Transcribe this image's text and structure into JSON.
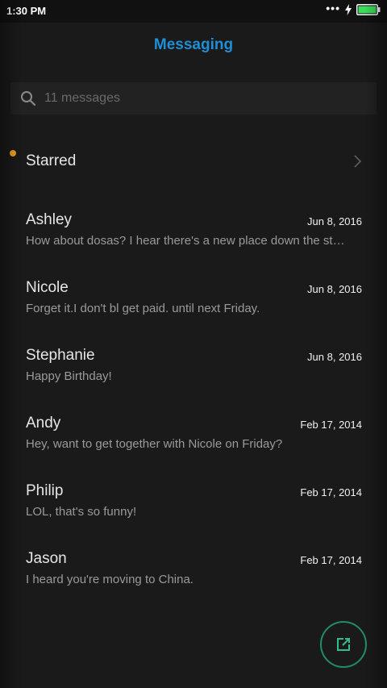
{
  "status_bar": {
    "time": "1:30 PM",
    "battery_color": "#3ddc5a"
  },
  "header": {
    "title": "Messaging",
    "title_color": "#1e8fd6"
  },
  "search": {
    "placeholder": "11 messages"
  },
  "starred": {
    "label": "Starred"
  },
  "conversations": [
    {
      "name": "Ashley",
      "date": "Jun 8, 2016",
      "preview": "How about dosas? I hear there's a new place down the st…",
      "unread": false
    },
    {
      "name": "Nicole",
      "date": "Jun 8, 2016",
      "preview": "Forget it.I don't bl get paid. until next Friday.",
      "unread": false
    },
    {
      "name": "Stephanie",
      "date": "Jun 8, 2016",
      "preview": "Happy Birthday!",
      "unread": true
    },
    {
      "name": "Andy",
      "date": "Feb 17, 2014",
      "preview": "Hey, want to get together with Nicole on Friday?",
      "unread": false
    },
    {
      "name": "Philip",
      "date": "Feb 17, 2014",
      "preview": "LOL, that's so funny!",
      "unread": false
    },
    {
      "name": "Jason",
      "date": "Feb 17, 2014",
      "preview": "I heard you're moving to China.",
      "unread": false
    }
  ],
  "unread_dot_color": "#f5a623",
  "compose": {
    "icon": "compose-icon",
    "accent_color": "#1f8c6a"
  }
}
